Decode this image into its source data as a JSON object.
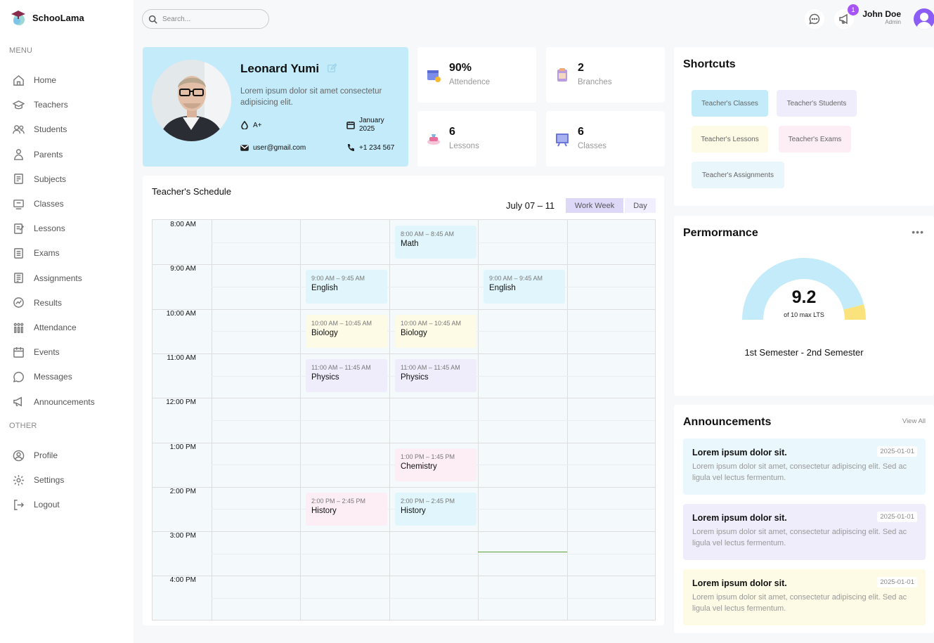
{
  "app": {
    "name": "SchooLama"
  },
  "sidebar": {
    "menu_label": "MENU",
    "other_label": "OTHER",
    "menu": [
      {
        "label": "Home",
        "icon": "home-icon"
      },
      {
        "label": "Teachers",
        "icon": "teacher-icon"
      },
      {
        "label": "Students",
        "icon": "students-icon"
      },
      {
        "label": "Parents",
        "icon": "parents-icon"
      },
      {
        "label": "Subjects",
        "icon": "subjects-icon"
      },
      {
        "label": "Classes",
        "icon": "classes-icon"
      },
      {
        "label": "Lessons",
        "icon": "lessons-icon"
      },
      {
        "label": "Exams",
        "icon": "exams-icon"
      },
      {
        "label": "Assignments",
        "icon": "assignments-icon"
      },
      {
        "label": "Results",
        "icon": "results-icon"
      },
      {
        "label": "Attendance",
        "icon": "attendance-icon"
      },
      {
        "label": "Events",
        "icon": "events-icon"
      },
      {
        "label": "Messages",
        "icon": "messages-icon"
      },
      {
        "label": "Announcements",
        "icon": "announcements-icon"
      }
    ],
    "other": [
      {
        "label": "Profile",
        "icon": "profile-icon"
      },
      {
        "label": "Settings",
        "icon": "settings-icon"
      },
      {
        "label": "Logout",
        "icon": "logout-icon"
      }
    ]
  },
  "topbar": {
    "search_placeholder": "Search...",
    "notification_count": "1",
    "user_name": "John Doe",
    "user_role": "Admin"
  },
  "profile": {
    "name": "Leonard Yumi",
    "description": "Lorem ipsum dolor sit amet consectetur adipisicing elit.",
    "blood_type": "A+",
    "date": "January 2025",
    "email": "user@gmail.com",
    "phone": "+1 234 567"
  },
  "stats": [
    {
      "value": "90%",
      "label": "Attendence",
      "icon": "attendance-icon"
    },
    {
      "value": "2",
      "label": "Branches",
      "icon": "branches-icon"
    },
    {
      "value": "6",
      "label": "Lessons",
      "icon": "lessons-icon"
    },
    {
      "value": "6",
      "label": "Classes",
      "icon": "classes-icon"
    }
  ],
  "schedule": {
    "title": "Teacher's Schedule",
    "range": "July 07 – 11",
    "views": [
      "Work Week",
      "Day"
    ],
    "active_view": "Work Week",
    "times": [
      "8:00 AM",
      "9:00 AM",
      "10:00 AM",
      "11:00 AM",
      "12:00 PM",
      "1:00 PM",
      "2:00 PM",
      "3:00 PM",
      "4:00 PM"
    ],
    "events": [
      {
        "day": 2,
        "hour": 0,
        "time": "8:00 AM – 8:45 AM",
        "subject": "Math",
        "color": "#e0f6fc"
      },
      {
        "day": 1,
        "hour": 1,
        "time": "9:00 AM – 9:45 AM",
        "subject": "English",
        "color": "#e0f6fc"
      },
      {
        "day": 3,
        "hour": 1,
        "time": "9:00 AM – 9:45 AM",
        "subject": "English",
        "color": "#e0f6fc"
      },
      {
        "day": 1,
        "hour": 2,
        "time": "10:00 AM – 10:45 AM",
        "subject": "Biology",
        "color": "#fdfbe6"
      },
      {
        "day": 2,
        "hour": 2,
        "time": "10:00 AM – 10:45 AM",
        "subject": "Biology",
        "color": "#fdfbe6"
      },
      {
        "day": 1,
        "hour": 3,
        "time": "11:00 AM – 11:45 AM",
        "subject": "Physics",
        "color": "#efedfc"
      },
      {
        "day": 2,
        "hour": 3,
        "time": "11:00 AM – 11:45 AM",
        "subject": "Physics",
        "color": "#efedfc"
      },
      {
        "day": 2,
        "hour": 5,
        "time": "1:00 PM – 1:45 PM",
        "subject": "Chemistry",
        "color": "#fdeef6"
      },
      {
        "day": 1,
        "hour": 6,
        "time": "2:00 PM – 2:45 PM",
        "subject": "History",
        "color": "#fdeef6"
      },
      {
        "day": 2,
        "hour": 6,
        "time": "2:00 PM – 2:45 PM",
        "subject": "History",
        "color": "#e0f6fc"
      }
    ]
  },
  "shortcuts": {
    "title": "Shortcuts",
    "items": [
      {
        "label": "Teacher's Classes",
        "color": "#c3ebfa"
      },
      {
        "label": "Teacher's Students",
        "color": "#efedfc"
      },
      {
        "label": "Teacher's Lessons",
        "color": "#fdfbe6"
      },
      {
        "label": "Teacher's Exams",
        "color": "#fdeef6"
      },
      {
        "label": "Teacher's Assignments",
        "color": "#e9f6fb"
      }
    ]
  },
  "performance": {
    "title": "Permormance",
    "score": "9.2",
    "score_value": 9.2,
    "max": 10,
    "subtitle": "of 10 max LTS",
    "semester": "1st Semester - 2nd Semester",
    "colors": {
      "fill": "#c3ebfa",
      "rest": "#fae27c"
    }
  },
  "announcements": {
    "title": "Announcements",
    "view_all": "View All",
    "items": [
      {
        "title": "Lorem ipsum dolor sit.",
        "date": "2025-01-01",
        "body": "Lorem ipsum dolor sit amet, consectetur adipiscing elit. Sed ac ligula vel lectus fermentum.",
        "color": "#eaf7fc"
      },
      {
        "title": "Lorem ipsum dolor sit.",
        "date": "2025-01-01",
        "body": "Lorem ipsum dolor sit amet, consectetur adipiscing elit. Sed ac ligula vel lectus fermentum.",
        "color": "#efedfc"
      },
      {
        "title": "Lorem ipsum dolor sit.",
        "date": "2025-01-01",
        "body": "Lorem ipsum dolor sit amet, consectetur adipiscing elit. Sed ac ligula vel lectus fermentum.",
        "color": "#fdfbe6"
      }
    ]
  }
}
